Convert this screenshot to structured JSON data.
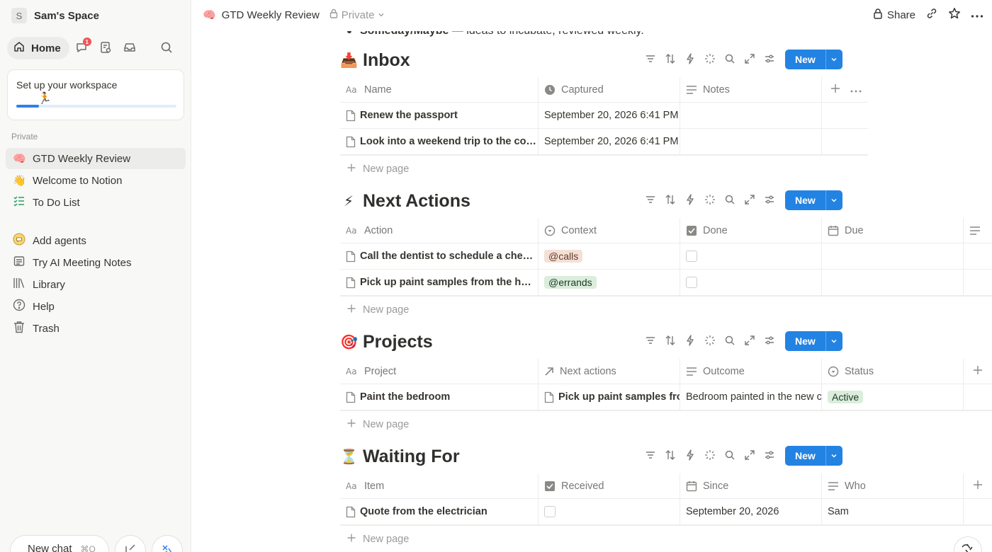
{
  "workspace": {
    "avatar": "S",
    "name": "Sam's Space"
  },
  "nav": {
    "home_label": "Home",
    "inbox_badge": "1"
  },
  "setup": {
    "text": "Set up your workspace",
    "progress": 0.14
  },
  "sidebar": {
    "section": "Private",
    "private_items": [
      {
        "emoji": "🧠",
        "label": "GTD Weekly Review"
      },
      {
        "emoji": "👋",
        "label": "Welcome to Notion"
      },
      {
        "emoji": "☑",
        "label": "To Do List"
      }
    ],
    "more_items": [
      {
        "label": "Add agents",
        "icon": "agent-icon"
      },
      {
        "label": "Try AI Meeting Notes",
        "icon": "meeting-notes-icon"
      },
      {
        "label": "Library",
        "icon": "library-icon"
      },
      {
        "label": "Help",
        "icon": "help-icon"
      },
      {
        "label": "Trash",
        "icon": "trash-icon"
      }
    ],
    "new_chat": "New chat",
    "new_chat_kbd": "⌘O"
  },
  "topbar": {
    "page_emoji": "🧠",
    "page_title": "GTD Weekly Review",
    "privacy": "Private",
    "share": "Share"
  },
  "content": {
    "bullet_bold": "Someday/Maybe",
    "bullet_rest": " — ideas to incubate, reviewed weekly.",
    "new_label": "New",
    "new_page": "New page",
    "inbox": {
      "emoji": "📥",
      "title": "Inbox",
      "columns": [
        "Name",
        "Captured",
        "Notes"
      ],
      "rows": [
        {
          "name": "Renew the passport",
          "captured": "September 20, 2026 6:41 PM",
          "notes": ""
        },
        {
          "name": "Look into a weekend trip to the co…",
          "captured": "September 20, 2026 6:41 PM",
          "notes": ""
        }
      ]
    },
    "next_actions": {
      "emoji": "⚡",
      "title": "Next Actions",
      "columns": [
        "Action",
        "Context",
        "Done",
        "Due"
      ],
      "rows": [
        {
          "action": "Call the dentist to schedule a che…",
          "context": "@calls",
          "done": false,
          "due": ""
        },
        {
          "action": "Pick up paint samples from the h…",
          "context": "@errands",
          "done": false,
          "due": ""
        }
      ]
    },
    "projects": {
      "emoji": "🎯",
      "title": "Projects",
      "columns": [
        "Project",
        "Next actions",
        "Outcome",
        "Status"
      ],
      "rows": [
        {
          "project": "Paint the bedroom",
          "next_actions": "Pick up paint samples fro",
          "outcome": "Bedroom painted in the new c",
          "status": "Active"
        }
      ]
    },
    "waiting_for": {
      "emoji": "⏳",
      "title": "Waiting For",
      "columns": [
        "Item",
        "Received",
        "Since",
        "Who"
      ],
      "rows": [
        {
          "item": "Quote from the electrician",
          "received": false,
          "since": "September 20, 2026",
          "who": "Sam"
        }
      ]
    }
  }
}
